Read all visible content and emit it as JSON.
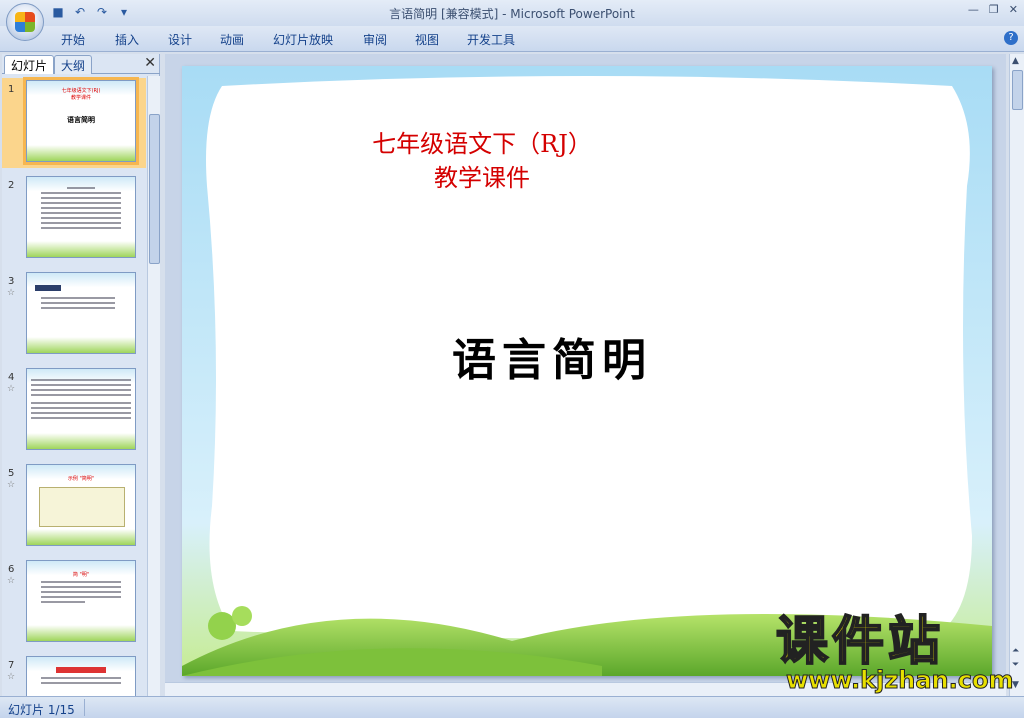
{
  "window": {
    "title": "言语简明 [兼容模式] - Microsoft PowerPoint"
  },
  "qat": {
    "icons": [
      "save-icon",
      "undo-icon",
      "redo-icon",
      "customize-icon"
    ]
  },
  "ribbon": {
    "tabs": [
      "开始",
      "插入",
      "设计",
      "动画",
      "幻灯片放映",
      "审阅",
      "视图",
      "开发工具"
    ]
  },
  "pane": {
    "tab_slides": "幻灯片",
    "tab_outline": "大纲",
    "close": "✕"
  },
  "thumbnails": [
    {
      "num": "1",
      "star": "",
      "selected": true
    },
    {
      "num": "2",
      "star": "",
      "selected": false
    },
    {
      "num": "3",
      "star": "☆",
      "selected": false
    },
    {
      "num": "4",
      "star": "☆",
      "selected": false
    },
    {
      "num": "5",
      "star": "☆",
      "selected": false
    },
    {
      "num": "6",
      "star": "☆",
      "selected": false
    },
    {
      "num": "7",
      "star": "☆",
      "selected": false
    }
  ],
  "slide": {
    "title_line1": "七年级语文下（RJ）",
    "title_line2": "教学课件",
    "main_title": "语言简明"
  },
  "watermark": {
    "name": "课件站",
    "url": "www.kjzhan.com"
  },
  "status": {
    "slide_info": "幻灯片 1/15"
  },
  "colors": {
    "accent": "#15428b",
    "title_red": "#d40000",
    "watermark_yellow": "#e8e000",
    "selection": "#f6b650"
  }
}
